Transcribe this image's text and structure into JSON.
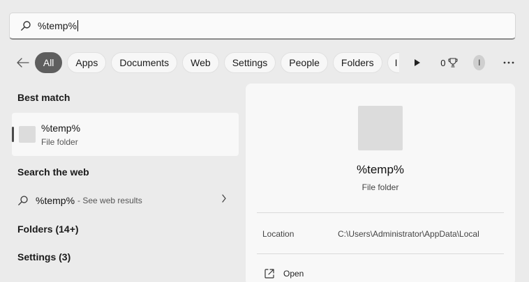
{
  "search": {
    "query": "%temp%"
  },
  "filters": {
    "chips": [
      {
        "label": "All",
        "active": true
      },
      {
        "label": "Apps",
        "active": false
      },
      {
        "label": "Documents",
        "active": false
      },
      {
        "label": "Web",
        "active": false
      },
      {
        "label": "Settings",
        "active": false
      },
      {
        "label": "People",
        "active": false
      },
      {
        "label": "Folders",
        "active": false
      },
      {
        "label": "I",
        "active": false
      }
    ],
    "points": "0",
    "avatar_initial": "I"
  },
  "results": {
    "best_match_title": "Best match",
    "best_match": {
      "name": "%temp%",
      "type": "File folder"
    },
    "web_title": "Search the web",
    "web_item": {
      "query": "%temp%",
      "hint": "- See web results"
    },
    "folders_title": "Folders (14+)",
    "settings_title": "Settings (3)"
  },
  "preview": {
    "name": "%temp%",
    "type": "File folder",
    "location_label": "Location",
    "location_value": "C:\\Users\\Administrator\\AppData\\Local",
    "open_label": "Open"
  },
  "icons": [
    "search-icon",
    "back-arrow-icon",
    "play-icon",
    "trophy-icon",
    "more-icon",
    "chevron-right-icon",
    "open-external-icon",
    "folder-thumbnail"
  ]
}
